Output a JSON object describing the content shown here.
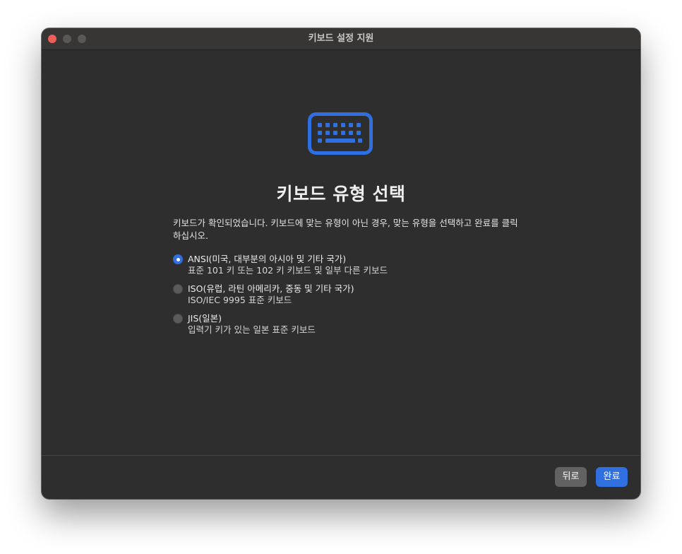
{
  "window": {
    "title": "키보드 설정 지원"
  },
  "main": {
    "icon": "keyboard-icon",
    "heading": "키보드 유형 선택",
    "description": "키보드가 확인되었습니다. 키보드에 맞는 유형이 아닌 경우, 맞는 유형을 선택하고 완료를 클릭하십시오.",
    "options": [
      {
        "label": "ANSI(미국, 대부분의 아시아 및 기타 국가)",
        "sub": "표준 101 키 또는 102 키 키보드 및 일부 다른 키보드",
        "selected": true
      },
      {
        "label": "ISO(유럽, 라틴 아메리카, 중동 및 기타 국가)",
        "sub": "ISO/IEC 9995 표준 키보드",
        "selected": false
      },
      {
        "label": "JIS(일본)",
        "sub": "입력기 키가 있는 일본 표준 키보드",
        "selected": false
      }
    ]
  },
  "footer": {
    "back_label": "뒤로",
    "done_label": "완료"
  },
  "colors": {
    "accent": "#2f6fe0",
    "window_bg": "#2f2e2e",
    "close_button": "#ec5f58"
  }
}
